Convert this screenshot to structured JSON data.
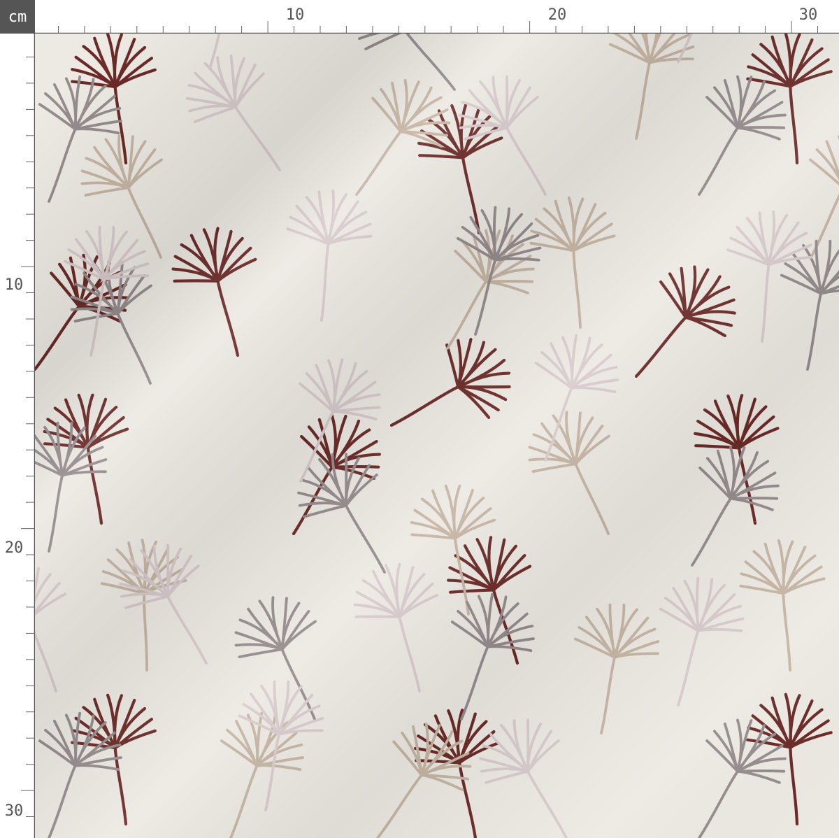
{
  "ruler": {
    "unit": "cm",
    "top_labels": [
      "10",
      "20",
      "30"
    ],
    "left_labels": [
      "10",
      "20",
      "30"
    ]
  },
  "colors": {
    "background": "#ede9e3",
    "ruler_text": "#555555",
    "badge_bg": "#555555",
    "leaf_maroon": "#6b2a27",
    "leaf_taupe": "#c6b5a3",
    "leaf_gray": "#958c8e",
    "leaf_pink": "#d8cbcd"
  }
}
